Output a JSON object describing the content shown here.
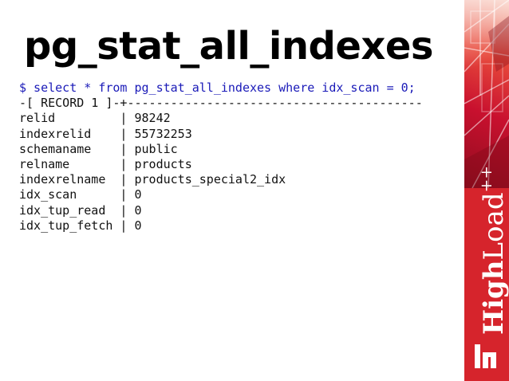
{
  "slide": {
    "title": "pg_stat_all_indexes"
  },
  "terminal": {
    "command": "$ select * from pg_stat_all_indexes where idx_scan = 0;",
    "record_header": "-[ RECORD 1 ]-+-----------------------------------------",
    "rows": [
      {
        "key": "relid",
        "value": "98242"
      },
      {
        "key": "indexrelid",
        "value": "55732253"
      },
      {
        "key": "schemaname",
        "value": "public"
      },
      {
        "key": "relname",
        "value": "products"
      },
      {
        "key": "indexrelname",
        "value": "products_special2_idx"
      },
      {
        "key": "idx_scan",
        "value": "0"
      },
      {
        "key": "idx_tup_read",
        "value": "0"
      },
      {
        "key": "idx_tup_fetch",
        "value": "0"
      }
    ]
  },
  "brand": {
    "logo_part1": "High",
    "logo_part2": "Load",
    "logo_part3": "++",
    "colors": {
      "accent": "#d6242c",
      "command_text": "#1a1ab8"
    }
  }
}
